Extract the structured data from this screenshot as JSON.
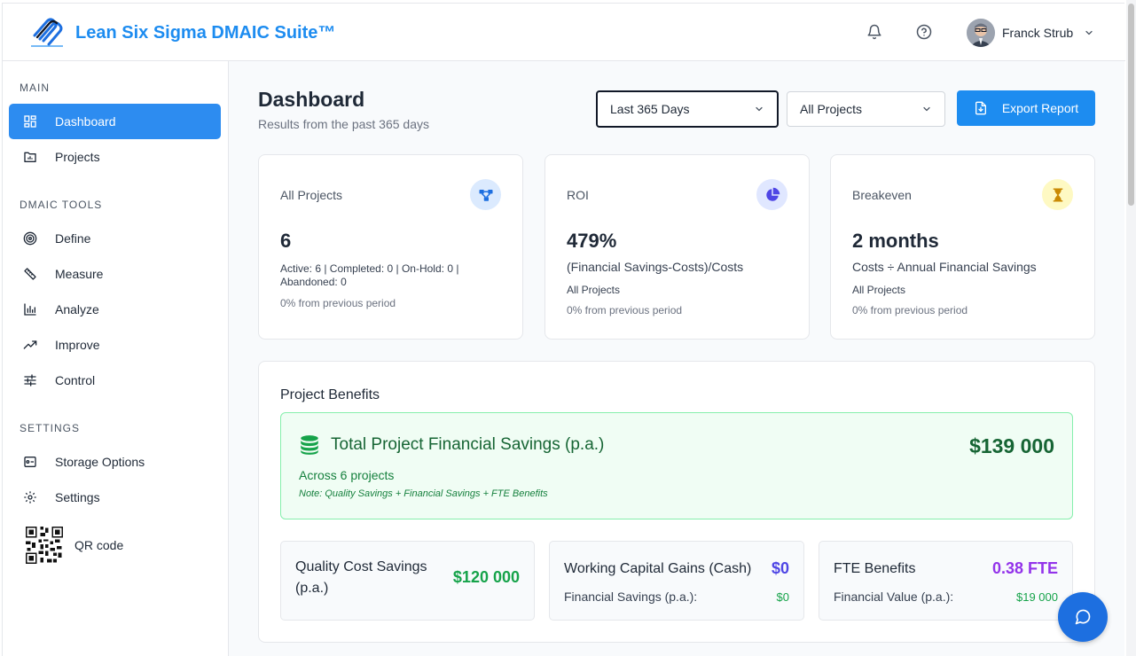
{
  "header": {
    "app_title": "Lean Six Sigma DMAIC Suite™",
    "user_name": "Franck Strub"
  },
  "sidebar": {
    "sections": {
      "main": "MAIN",
      "dmaic": "DMAIC TOOLS",
      "settings": "SETTINGS"
    },
    "items": {
      "dashboard": "Dashboard",
      "projects": "Projects",
      "define": "Define",
      "measure": "Measure",
      "analyze": "Analyze",
      "improve": "Improve",
      "control": "Control",
      "storage": "Storage Options",
      "settings": "Settings",
      "qr": "QR code"
    }
  },
  "page": {
    "title": "Dashboard",
    "subtitle": "Results from the past 365 days",
    "period_select": "Last 365 Days",
    "project_select": "All Projects",
    "export_label": "Export Report"
  },
  "cards": {
    "projects": {
      "label": "All Projects",
      "value": "6",
      "detail": "Active: 6 | Completed: 0 | On-Hold: 0 | Abandoned: 0",
      "change": "0% from previous period"
    },
    "roi": {
      "label": "ROI",
      "value": "479%",
      "formula": "(Financial Savings-Costs)/Costs",
      "scope": "All Projects",
      "change": "0% from previous period"
    },
    "breakeven": {
      "label": "Breakeven",
      "value": "2 months",
      "formula": "Costs ÷ Annual Financial Savings",
      "scope": "All Projects",
      "change": "0% from previous period"
    }
  },
  "benefits": {
    "title": "Project Benefits",
    "total_title": "Total Project Financial Savings (p.a.)",
    "total_value": "$139 000",
    "total_sub": "Across 6 projects",
    "total_note": "Note: Quality Savings + Financial Savings + FTE Benefits",
    "quality": {
      "title_line1": "Quality Cost Savings",
      "title_line2": "(p.a.)",
      "value": "$120 000"
    },
    "working_capital": {
      "title": "Working Capital Gains (Cash)",
      "value": "$0",
      "sub_label": "Financial Savings (p.a.):",
      "sub_value": "$0"
    },
    "fte": {
      "title": "FTE Benefits",
      "value": "0.38 FTE",
      "sub_label": "Financial Value (p.a.):",
      "sub_value": "$19 000"
    }
  },
  "colors": {
    "brand": "#1d8cf0",
    "active_nav": "#2d8cf0",
    "success": "#16a34a",
    "indigo": "#4f46e5",
    "purple": "#9333ea"
  },
  "icons": {
    "notification": "bell-icon",
    "help": "help-circle-icon",
    "user_menu": "chevron-down-icon",
    "chat": "chat-bubble-icon"
  }
}
